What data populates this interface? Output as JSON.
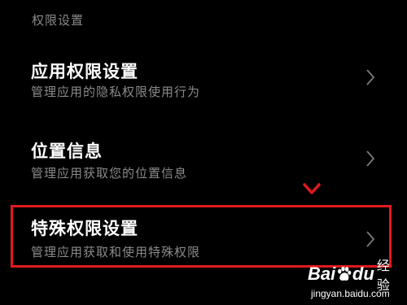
{
  "section_header": "权限设置",
  "items": [
    {
      "title": "应用权限设置",
      "subtitle": "管理应用的隐私权限使用行为"
    },
    {
      "title": "位置信息",
      "subtitle": "管理应用获取您的位置信息"
    },
    {
      "title": "特殊权限设置",
      "subtitle": "管理应用获取和使用特殊权限"
    }
  ],
  "highlight_color": "#e0191f",
  "watermark": {
    "brand_left": "Bai",
    "brand_right": "du",
    "brand_cn": "经验",
    "url": "jingyan.baidu.com"
  },
  "icons": {
    "chevron": "chevron-right-icon",
    "pointer": "down-arrow-marker-icon",
    "paw": "baidu-paw-icon"
  }
}
